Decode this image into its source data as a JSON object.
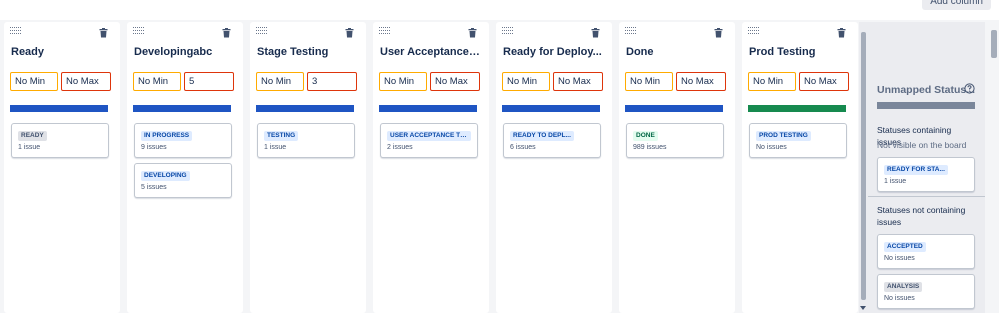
{
  "header": {
    "add_column_label": "Add column"
  },
  "columns": [
    {
      "title": "Ready",
      "min_placeholder": "No Min",
      "max_placeholder": "No Max",
      "min_value": "",
      "max_value": "",
      "bar_color": "#1f55c3",
      "statuses": [
        {
          "label": "READY",
          "count": "1 issue",
          "lozenge_bg": "#dfe1e6",
          "lozenge_fg": "#42526e"
        }
      ]
    },
    {
      "title": "Developingabc",
      "min_placeholder": "No Min",
      "max_placeholder": "No Max",
      "min_value": "",
      "max_value": "5",
      "bar_color": "#1f55c3",
      "statuses": [
        {
          "label": "IN PROGRESS",
          "count": "9 issues",
          "lozenge_bg": "#deebff",
          "lozenge_fg": "#0747a6"
        },
        {
          "label": "DEVELOPING",
          "count": "5 issues",
          "lozenge_bg": "#deebff",
          "lozenge_fg": "#0747a6"
        }
      ]
    },
    {
      "title": "Stage Testing",
      "min_placeholder": "No Min",
      "max_placeholder": "No Max",
      "min_value": "",
      "max_value": "3",
      "bar_color": "#1f55c3",
      "statuses": [
        {
          "label": "TESTING",
          "count": "1 issue",
          "lozenge_bg": "#deebff",
          "lozenge_fg": "#0747a6"
        }
      ]
    },
    {
      "title": "User Acceptance T...",
      "min_placeholder": "No Min",
      "max_placeholder": "No Max",
      "min_value": "",
      "max_value": "",
      "bar_color": "#1f55c3",
      "statuses": [
        {
          "label": "USER ACCEPTANCE TE...",
          "count": "2 issues",
          "lozenge_bg": "#deebff",
          "lozenge_fg": "#0747a6"
        }
      ]
    },
    {
      "title": "Ready for Deploy...",
      "min_placeholder": "No Min",
      "max_placeholder": "No Max",
      "min_value": "",
      "max_value": "",
      "bar_color": "#1f55c3",
      "statuses": [
        {
          "label": "READY TO DEPL...",
          "count": "6 issues",
          "lozenge_bg": "#deebff",
          "lozenge_fg": "#0747a6"
        }
      ]
    },
    {
      "title": "Done",
      "min_placeholder": "No Min",
      "max_placeholder": "No Max",
      "min_value": "",
      "max_value": "",
      "bar_color": "#1f55c3",
      "statuses": [
        {
          "label": "DONE",
          "count": "989 issues",
          "lozenge_bg": "#e3fcef",
          "lozenge_fg": "#006644"
        }
      ]
    },
    {
      "title": "Prod Testing",
      "min_placeholder": "No Min",
      "max_placeholder": "No Max",
      "min_value": "",
      "max_value": "",
      "bar_color": "#168a4f",
      "statuses": [
        {
          "label": "PROD TESTING",
          "count": "No issues",
          "lozenge_bg": "#deebff",
          "lozenge_fg": "#0747a6"
        }
      ]
    }
  ],
  "unmapped": {
    "title": "Unmapped Status...",
    "help_icon": "question-circle-icon",
    "containing_heading": "Statuses containing issues",
    "containing_note": "Not visible on the board",
    "containing": [
      {
        "label": "READY FOR STA...",
        "count": "1 issue",
        "lozenge_bg": "#deebff",
        "lozenge_fg": "#0747a6"
      }
    ],
    "not_containing_heading": "Statuses not containing issues",
    "not_containing": [
      {
        "label": "ACCEPTED",
        "count": "No issues",
        "lozenge_bg": "#deebff",
        "lozenge_fg": "#0747a6"
      },
      {
        "label": "ANALYSIS",
        "count": "No issues",
        "lozenge_bg": "#dfe1e6",
        "lozenge_fg": "#42526e"
      }
    ]
  },
  "icons": {
    "drag": "drag-handle-icon",
    "delete": "trash-icon"
  }
}
